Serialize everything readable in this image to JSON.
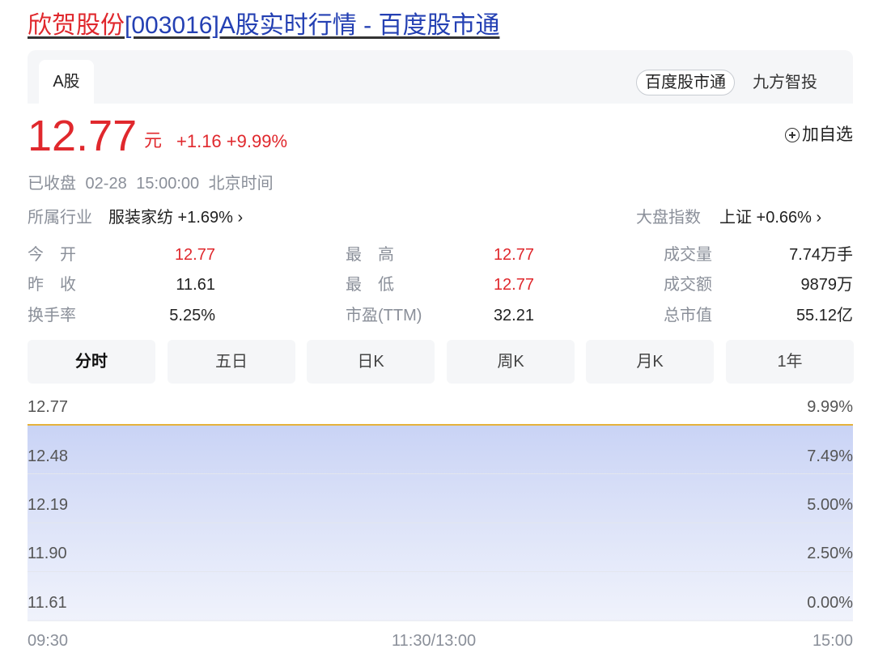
{
  "title": {
    "name": "欣贺股份",
    "rest": "[003016]A股实时行情 - 百度股市通"
  },
  "tabbar": {
    "tab": "A股",
    "source_active": "百度股市通",
    "source_other": "九方智投"
  },
  "quote": {
    "price": "12.77",
    "unit": "元",
    "change": "+1.16 +9.99%",
    "watch_label": "加自选"
  },
  "status_text": "已收盘 02-28 15:00:00 北京时间",
  "industry": {
    "label": "所属行业",
    "value": "服装家纺 +1.69% ›"
  },
  "market": {
    "label": "大盘指数",
    "value": "上证 +0.66% ›"
  },
  "stats": [
    {
      "label": "今　开",
      "value": "12.77"
    },
    {
      "label": "昨　收",
      "value": "11.61"
    },
    {
      "label": "换手率",
      "value": "5.25%"
    },
    {
      "label": "最　高",
      "value": "12.77"
    },
    {
      "label": "最　低",
      "value": "12.77"
    },
    {
      "label": "市盈(TTM)",
      "value": "32.21"
    },
    {
      "label": "成交量",
      "value": "7.74万手"
    },
    {
      "label": "成交额",
      "value": "9879万"
    },
    {
      "label": "总市值",
      "value": "55.12亿"
    }
  ],
  "period_tabs": [
    "分时",
    "五日",
    "日K",
    "周K",
    "月K",
    "1年"
  ],
  "chart_data": {
    "type": "area",
    "series": [
      {
        "x": [
          "09:30",
          "15:00"
        ],
        "y": [
          12.77,
          12.77
        ]
      }
    ],
    "y_ticks": [
      "12.77",
      "12.48",
      "12.19",
      "11.90",
      "11.61"
    ],
    "pct_ticks": [
      "9.99%",
      "7.49%",
      "5.00%",
      "2.50%",
      "0.00%"
    ],
    "x_ticks": [
      "09:30",
      "11:30/13:00",
      "15:00"
    ],
    "ylim": [
      11.61,
      12.77
    ],
    "line_color": "#e5b23c",
    "fill_color": "#c9d3f5"
  }
}
